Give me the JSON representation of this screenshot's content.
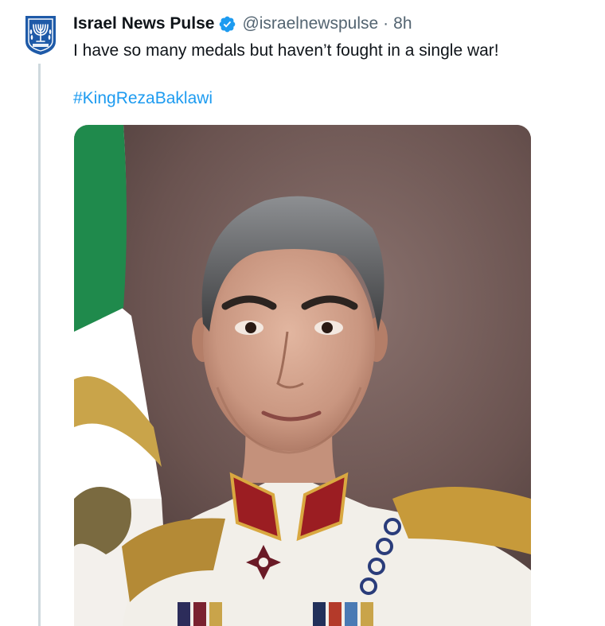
{
  "tweet": {
    "author": {
      "display_name": "Israel News Pulse",
      "handle": "@israelnewspulse",
      "verified": true,
      "avatar_icon": "menorah-emblem-icon"
    },
    "separator": "·",
    "timestamp": "8h",
    "text": "I have so many medals but haven’t fought in a single war!",
    "hashtag": "#KingRezaBaklawi",
    "media": {
      "type": "photo",
      "subject": "portrait-photo"
    }
  },
  "colors": {
    "text_primary": "#0f1419",
    "text_secondary": "#536471",
    "link": "#1d9bf0",
    "verified_badge": "#1d9bf0",
    "avatar_blue": "#1e5aa8",
    "thread_line": "#cfd9de"
  }
}
